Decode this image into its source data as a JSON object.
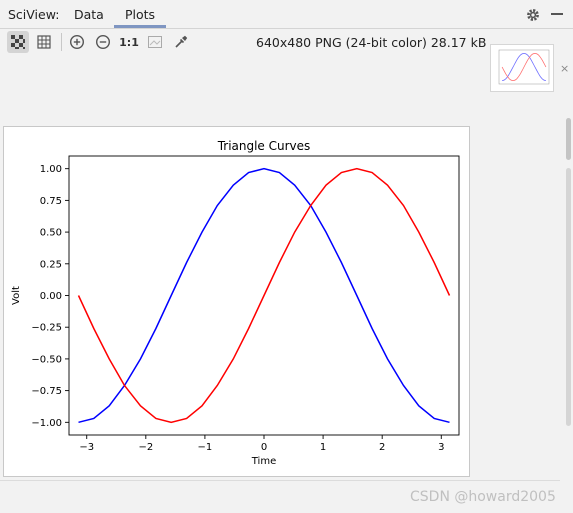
{
  "header": {
    "app_title": "SciView:",
    "tabs": [
      {
        "label": "Data",
        "active": false
      },
      {
        "label": "Plots",
        "active": true
      }
    ],
    "icons": [
      "gear-icon",
      "minimize-icon"
    ]
  },
  "toolbar": {
    "icons": [
      "transparency-checker-icon",
      "grid-icon",
      "zoom-in-icon",
      "zoom-out-icon",
      "actual-size-icon",
      "fit-image-icon",
      "eyedropper-icon"
    ],
    "actual_size_label": "1:1",
    "image_info": "640x480 PNG (24-bit color) 28.17 kB"
  },
  "thumbnail": {
    "close_label": "×"
  },
  "watermark": "CSDN @howard2005",
  "colors": {
    "accent": "#7f96c2",
    "series_blue": "#0000ff",
    "series_red": "#ff0000"
  },
  "chart_data": {
    "type": "line",
    "title": "Triangle Curves",
    "xlabel": "Time",
    "ylabel": "Volt",
    "xlim": [
      -3.3,
      3.3
    ],
    "ylim": [
      -1.1,
      1.1
    ],
    "xticks": [
      -3,
      -2,
      -1,
      0,
      1,
      2,
      3
    ],
    "xtick_labels": [
      "−3",
      "−2",
      "−1",
      "0",
      "1",
      "2",
      "3"
    ],
    "yticks": [
      -1.0,
      -0.75,
      -0.5,
      -0.25,
      0.0,
      0.25,
      0.5,
      0.75,
      1.0
    ],
    "ytick_labels": [
      "−1.00",
      "−0.75",
      "−0.50",
      "−0.25",
      "0.00",
      "0.25",
      "0.50",
      "0.75",
      "1.00"
    ],
    "grid": false,
    "legend": false,
    "series": [
      {
        "color": "#0000ff",
        "x": [
          -3.14,
          -2.88,
          -2.62,
          -2.36,
          -2.09,
          -1.83,
          -1.57,
          -1.31,
          -1.05,
          -0.79,
          -0.52,
          -0.26,
          0.0,
          0.26,
          0.52,
          0.79,
          1.05,
          1.31,
          1.57,
          1.83,
          2.09,
          2.36,
          2.62,
          2.88,
          3.14
        ],
        "y": [
          -1.0,
          -0.97,
          -0.87,
          -0.71,
          -0.5,
          -0.26,
          0.0,
          0.26,
          0.5,
          0.71,
          0.87,
          0.97,
          1.0,
          0.97,
          0.87,
          0.71,
          0.5,
          0.26,
          0.0,
          -0.26,
          -0.5,
          -0.71,
          -0.87,
          -0.97,
          -1.0
        ]
      },
      {
        "color": "#ff0000",
        "x": [
          -3.14,
          -2.88,
          -2.62,
          -2.36,
          -2.09,
          -1.83,
          -1.57,
          -1.31,
          -1.05,
          -0.79,
          -0.52,
          -0.26,
          0.0,
          0.26,
          0.52,
          0.79,
          1.05,
          1.31,
          1.57,
          1.83,
          2.09,
          2.36,
          2.62,
          2.88,
          3.14
        ],
        "y": [
          0.0,
          -0.26,
          -0.5,
          -0.71,
          -0.87,
          -0.97,
          -1.0,
          -0.97,
          -0.87,
          -0.71,
          -0.5,
          -0.26,
          0.0,
          0.26,
          0.5,
          0.71,
          0.87,
          0.97,
          1.0,
          0.97,
          0.87,
          0.71,
          0.5,
          0.26,
          0.0
        ]
      }
    ]
  }
}
